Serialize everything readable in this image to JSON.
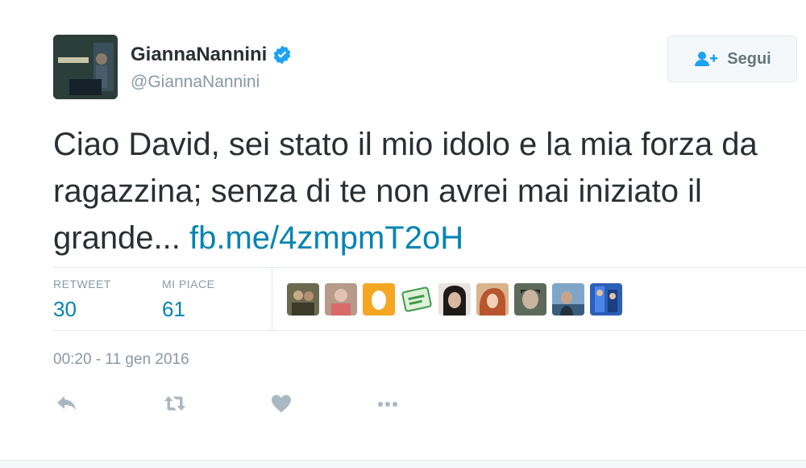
{
  "user": {
    "display_name": "GiannaNannini",
    "handle": "@GiannaNannini",
    "verified": true,
    "avatar_icon": "album-cover-avatar"
  },
  "follow_button": {
    "label": "Segui",
    "icon": "add-user-icon"
  },
  "tweet": {
    "text": "Ciao David, sei stato il mio idolo e la mia forza da ragazzina; senza di te non avrei mai iniziato il grande...",
    "link": "fb.me/4zmpmT2oH"
  },
  "stats": {
    "retweet_label": "RETWEET",
    "retweet_count": "30",
    "like_label": "MI PIACE",
    "like_count": "61"
  },
  "liker_faces": [
    "face-1",
    "face-2",
    "egg-avatar",
    "face-sticker",
    "face-5",
    "face-6",
    "face-7",
    "face-8",
    "face-9"
  ],
  "timestamp": "00:20 - 11 gen 2016",
  "actions": [
    "reply-icon",
    "retweet-icon",
    "like-icon",
    "more-icon"
  ],
  "colors": {
    "link": "#0084b4",
    "text": "#292f33",
    "muted": "#8899a6",
    "verified": "#1da1f2",
    "border": "#e1e8ed"
  }
}
